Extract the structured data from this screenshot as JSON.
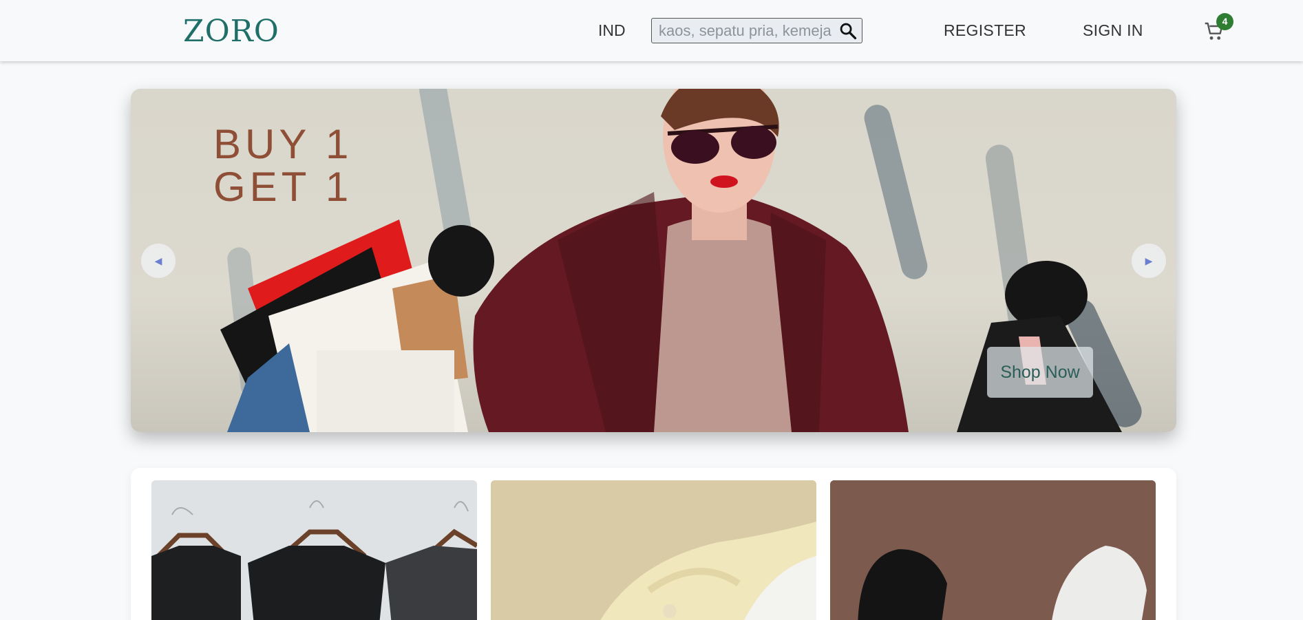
{
  "header": {
    "logo_text": "ZORO",
    "language": "IND",
    "search_placeholder": "kaos, sepatu pria, kemeja",
    "register_label": "REGISTER",
    "signin_label": "SIGN IN",
    "cart_icon": "shopping-cart-icon",
    "cart_count": "4",
    "brand_color": "#1f6e68",
    "badge_color": "#2e7d32"
  },
  "hero": {
    "title_line1": "BUY 1",
    "title_line2": "GET 1",
    "shop_now_label": "Shop Now",
    "prev_icon": "chevron-left-icon",
    "next_icon": "chevron-right-icon",
    "image": "woman-with-shopping-bags-photo",
    "title_color": "#8e4f36"
  },
  "categories": [
    {
      "image": "black-tshirts-on-hangers-photo"
    },
    {
      "image": "yellow-white-shirts-photo"
    },
    {
      "image": "black-white-hoodies-photo"
    }
  ]
}
